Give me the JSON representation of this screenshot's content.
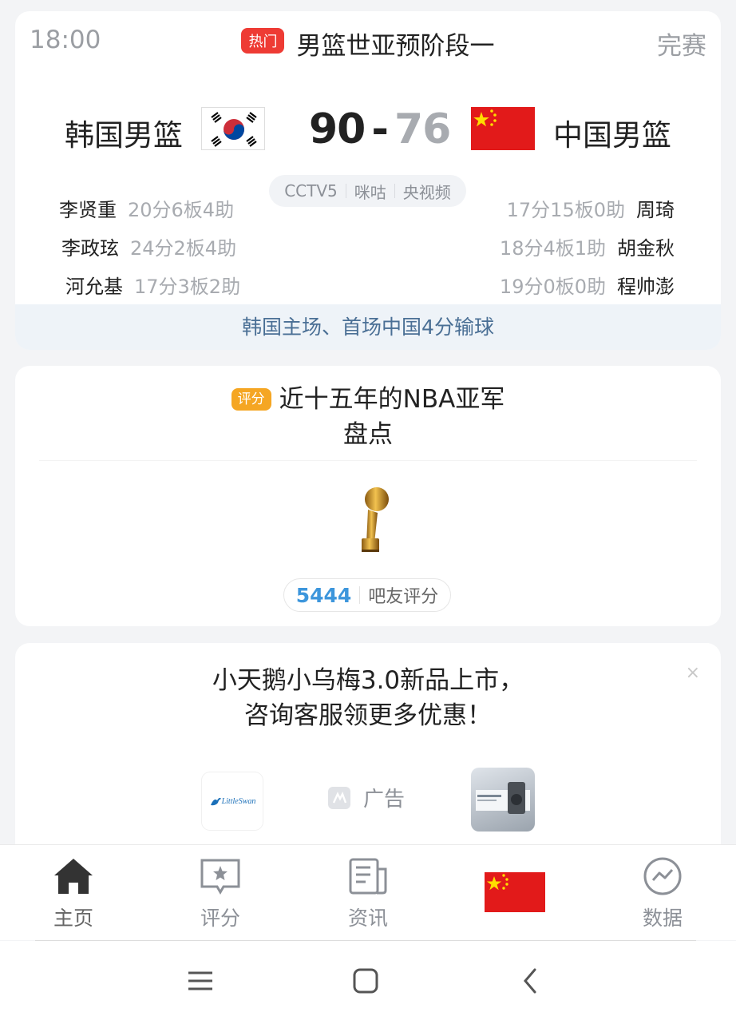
{
  "match": {
    "time": "18:00",
    "hot_badge": "热门",
    "title": "男篮世亚预阶段一",
    "status": "完赛",
    "home_team": "韩国男篮",
    "away_team": "中国男篮",
    "home_score": "90",
    "score_sep": "-",
    "away_score": "76",
    "channels": [
      "CCTV5",
      "咪咕",
      "央视频"
    ],
    "home_players": [
      {
        "name": "李贤重",
        "stat": "20分6板4助"
      },
      {
        "name": "李政玹",
        "stat": "24分2板4助"
      },
      {
        "name": "河允基",
        "stat": "17分3板2助"
      }
    ],
    "away_players": [
      {
        "name": "周琦",
        "stat": "17分15板0助"
      },
      {
        "name": "胡金秋",
        "stat": "18分4板1助"
      },
      {
        "name": "程帅澎",
        "stat": "19分0板0助"
      }
    ],
    "footer": "韩国主场、首场中国4分输球",
    "colors": {
      "hot": "#ee3b34",
      "score_away": "#a8abb0",
      "footer_text": "#4a6f95"
    }
  },
  "rating": {
    "badge": "评分",
    "title_line1": "近十五年的NBA亚军",
    "title_line2": "盘点",
    "count": "5444",
    "count_label": "吧友评分",
    "image_icon": "trophy-icon",
    "colors": {
      "badge": "#f5a623",
      "count": "#3d96dc"
    }
  },
  "ad": {
    "line1": "小天鹅小乌梅3.0新品上市，",
    "line2": "咨询客服领更多优惠！",
    "close": "×",
    "logo_text": "LittleSwan",
    "label": "广告"
  },
  "nav": {
    "items": [
      {
        "label": "主页",
        "icon": "home-icon"
      },
      {
        "label": "评分",
        "icon": "rating-icon"
      },
      {
        "label": "资讯",
        "icon": "news-icon"
      },
      {
        "label": "",
        "icon": "china-flag"
      },
      {
        "label": "数据",
        "icon": "data-icon"
      }
    ]
  },
  "system": {
    "buttons": [
      "recent-apps-icon",
      "home-button-icon",
      "back-icon"
    ]
  }
}
